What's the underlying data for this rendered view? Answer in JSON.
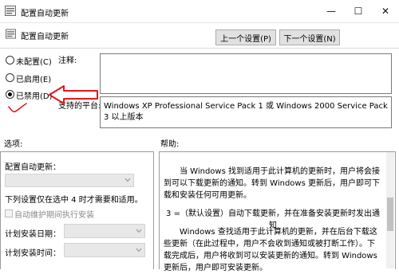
{
  "window": {
    "title": "配置自动更新",
    "minimize": "—",
    "maximize": "☐",
    "close": "✕"
  },
  "header": {
    "title": "配置自动更新",
    "prev_button": "上一个设置(P)",
    "next_button": "下一个设置(N)"
  },
  "state": {
    "options": [
      {
        "label": "未配置(C)",
        "checked": false
      },
      {
        "label": "已启用(E)",
        "checked": false
      },
      {
        "label": "已禁用(D)",
        "checked": true
      }
    ]
  },
  "comment": {
    "label": "注释:",
    "value": ""
  },
  "platform": {
    "label": "支持的平台:",
    "value": "Windows XP Professional Service Pack 1 或 Windows 2000 Service Pack 3 以上版本"
  },
  "options_pane": {
    "title": "选项:",
    "config_label": "配置自动更新：",
    "note": "下列设置仅在选中 4 时才需要和适用。",
    "checkbox_label": "自动维护期间执行安装",
    "schedule_day_label": "计划安装日期：",
    "schedule_time_label": "计划安装时间："
  },
  "help_pane": {
    "title": "帮助:",
    "paragraphs": [
      "当 Windows 找到适用于此计算机的更新时，用户将会接到可以下载更新的通知。转到 Windows 更新后，用户即可下载和安装任何可用更新。",
      "3 =（默认设置）自动下载更新，并在准备安装更新时发出通知",
      "Windows 查找适用于此计算机的更新，并在后台下载这些更新（在此过程中，用户不会收到通知或被打断工作）。下载完成后，用户将收到可以安装更新的通知。转到 Windows 更新后，用户即可安装更新。"
    ]
  },
  "annotation": {
    "color": "#e8141c"
  }
}
